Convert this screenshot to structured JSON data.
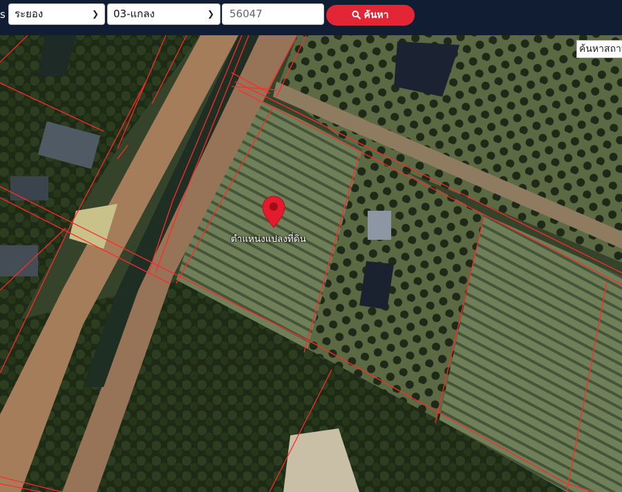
{
  "header": {
    "left_cut_label": "s",
    "province_select": {
      "value": "ระยอง"
    },
    "district_select": {
      "value": "03-แกลง"
    },
    "parcel_input": {
      "value": "56047"
    },
    "search_button": {
      "label": "ค้นหา"
    }
  },
  "map": {
    "place_search_placeholder": "ค้นหาสถาน",
    "marker_label": "ตำแหน่งแปลงที่ดิน",
    "parcel_line_color": "#ff2a2a",
    "marker_color": "#e31b2c"
  }
}
